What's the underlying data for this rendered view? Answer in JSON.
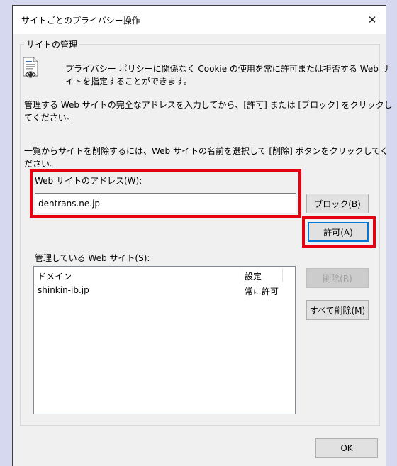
{
  "dialog": {
    "title": "サイトごとのプライバシー操作",
    "close_glyph": "✕",
    "group_label": "サイトの管理",
    "info_line1": "プライバシー ポリシーに関係なく Cookie の使用を常に許可または拒否する Web サ",
    "info_line2": "イトを指定することができます。",
    "instr1_line1": "管理する Web サイトの完全なアドレスを入力してから、[許可] または [ブロック] をクリックし",
    "instr1_line2": "てください。",
    "instr2_line1": "一覧からサイトを削除するには、Web サイトの名前を選択して [削除] ボタンをクリックしてく",
    "instr2_line2": "ださい。",
    "address_label": "Web サイトのアドレス(W):",
    "address_value": "dentrans.ne.jp",
    "block_button": "ブロック(B)",
    "allow_button": "許可(A)",
    "managed_label": "管理している Web サイト(S):",
    "list_headers": {
      "domain": "ドメイン",
      "setting": "設定"
    },
    "list_rows": [
      {
        "domain": "shinkin-ib.jp",
        "setting": "常に許可"
      }
    ],
    "remove_button": "削除(R)",
    "remove_all_button": "すべて削除(M)",
    "ok_button": "OK"
  },
  "colors": {
    "highlight": "#e50012",
    "background": "#d5d8ef",
    "dialog": "#f0f0f0",
    "focus": "#0078d7"
  },
  "icons": [
    "privacy-document-icon",
    "close-icon"
  ]
}
